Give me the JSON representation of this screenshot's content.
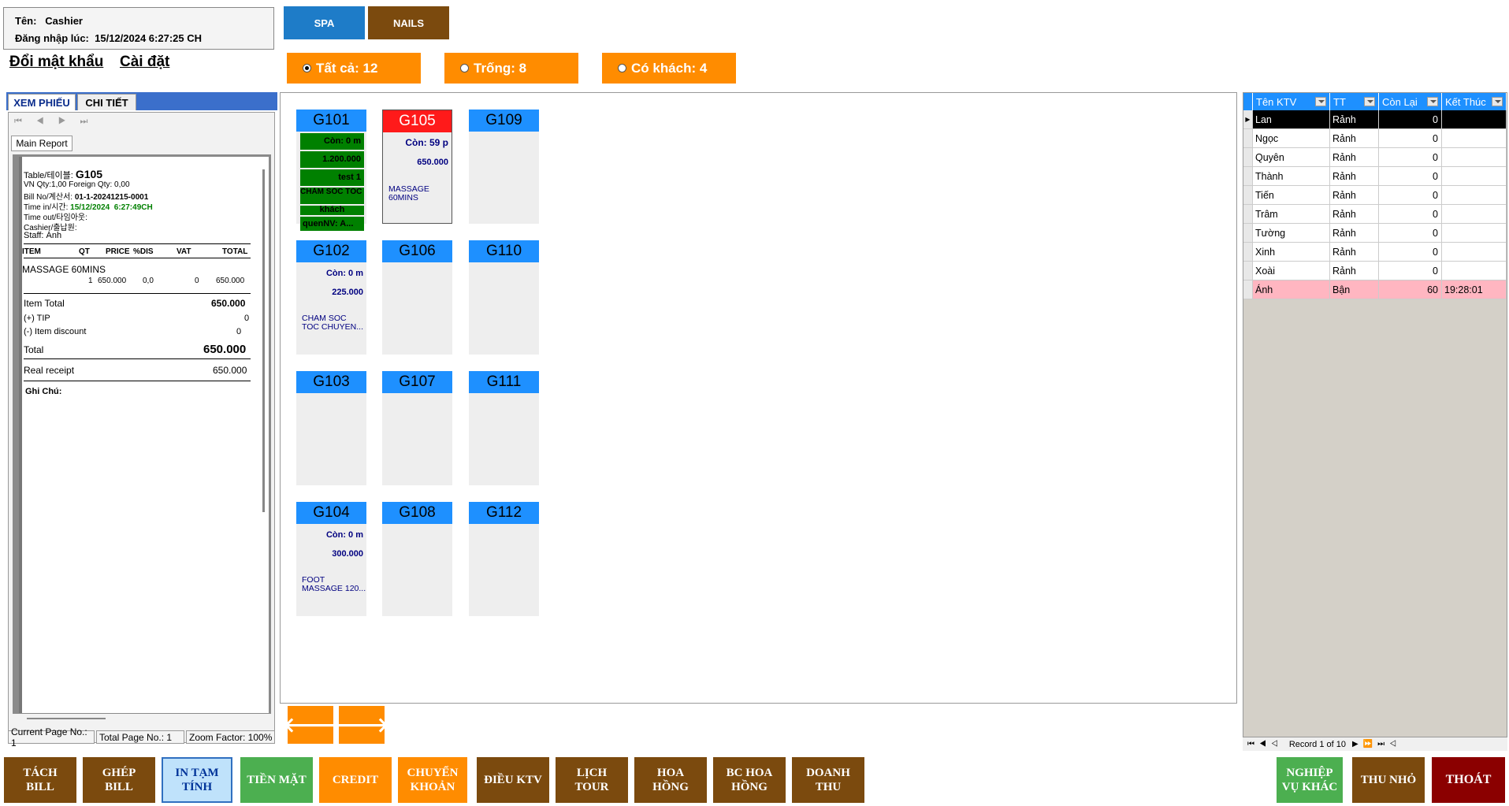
{
  "user": {
    "name_label": "Tên:",
    "name": "Cashier",
    "login_label": "Đăng nhập lúc:",
    "login_time": "15/12/2024 6:27:25 CH"
  },
  "top_tabs": {
    "spa": "SPA",
    "nails": "NAILS"
  },
  "links": {
    "change_password": "Đổi mật khẩu",
    "settings": "Cài đặt"
  },
  "filters": {
    "all": "Tất cả: 12",
    "empty": "Trống: 8",
    "occupied": "Có khách: 4"
  },
  "left_tabs": {
    "view_bill": "XEM PHIẾU",
    "detail": "CHI TIẾT"
  },
  "report": {
    "tab": "Main Report",
    "table_label": "Table/테이블:",
    "table": "G105",
    "qty_line": "VN Qty:1,00   Foreign Qty: 0,00",
    "bill_label": "Bill No/계산서:",
    "bill_no": "01-1-20241215-0001",
    "timein_label": "Time in/시간:",
    "timein_date": "15/12/2024",
    "timein_time": "6:27:49CH",
    "timeout_label": "Time out/타임아웃:",
    "cashier_label": "Cashier/출납원:",
    "staff_label": "Staff:",
    "staff": "Ánh",
    "col_item": "ITEM",
    "col_qt": "QT",
    "col_price": "PRICE",
    "col_dis": "%DIS",
    "col_vat": "VAT",
    "col_total": "TOTAL",
    "item_name": "MASSAGE 60MINS",
    "item_qt": "1",
    "item_price": "650.000",
    "item_dis": "0,0",
    "item_vat": "0",
    "item_total": "650.000",
    "item_total_label": "Item Total",
    "item_total_value": "650.000",
    "tip_label": "(+) TIP",
    "tip_value": "0",
    "discount_label": "(-)  Item discount",
    "discount_value": "0",
    "total_label": "Total",
    "total_value": "650.000",
    "receipt_label": "Real receipt",
    "receipt_value": "650.000",
    "note_label": "Ghi Chú:"
  },
  "status_bar": {
    "current_page": "Current Page No.: 1",
    "total_page": "Total Page No.: 1",
    "zoom": "Zoom Factor: 100%"
  },
  "rooms": {
    "g101": {
      "name": "G101",
      "remain": "Còn: 0 m",
      "amount": "1.200.000",
      "note": "test 1",
      "service": "CHĂM SÓC TÓC + HA...",
      "extra": "khách",
      "staff": "quenNV: A..."
    },
    "g102": {
      "name": "G102",
      "remain": "Còn: 0 m",
      "amount": "225.000",
      "service_1": "CHAM SOC",
      "service_2": "TOC CHUYEN..."
    },
    "g103": {
      "name": "G103"
    },
    "g104": {
      "name": "G104",
      "remain": "Còn: 0 m",
      "amount": "300.000",
      "service_1": "FOOT",
      "service_2": "MASSAGE 120..."
    },
    "g105": {
      "name": "G105",
      "remain": "Còn: 59 p",
      "amount": "650.000",
      "service_1": "MASSAGE",
      "service_2": "60MINS"
    },
    "g106": {
      "name": "G106"
    },
    "g107": {
      "name": "G107"
    },
    "g108": {
      "name": "G108"
    },
    "g109": {
      "name": "G109"
    },
    "g110": {
      "name": "G110"
    },
    "g111": {
      "name": "G111"
    },
    "g112": {
      "name": "G112"
    }
  },
  "grid": {
    "headers": [
      "Tên KTV",
      "TT",
      "Còn Lại",
      "Kết Thúc"
    ],
    "rows": [
      {
        "name": "Lan",
        "status": "Rảnh",
        "remain": "0",
        "end": ""
      },
      {
        "name": "Ngọc",
        "status": "Rảnh",
        "remain": "0",
        "end": ""
      },
      {
        "name": "Quyên",
        "status": "Rảnh",
        "remain": "0",
        "end": ""
      },
      {
        "name": "Thành",
        "status": "Rảnh",
        "remain": "0",
        "end": ""
      },
      {
        "name": "Tiến",
        "status": "Rảnh",
        "remain": "0",
        "end": ""
      },
      {
        "name": "Trâm",
        "status": "Rảnh",
        "remain": "0",
        "end": ""
      },
      {
        "name": "Tường",
        "status": "Rảnh",
        "remain": "0",
        "end": ""
      },
      {
        "name": "Xinh",
        "status": "Rảnh",
        "remain": "0",
        "end": ""
      },
      {
        "name": "Xoài",
        "status": "Rảnh",
        "remain": "0",
        "end": ""
      },
      {
        "name": "Ánh",
        "status": "Bận",
        "remain": "60",
        "end": "19:28:01"
      }
    ],
    "record_label": "Record 1 of 10"
  },
  "bottom_buttons": {
    "split_bill": [
      "TÁCH",
      "BILL"
    ],
    "merge_bill": [
      "GHÉP",
      "BILL"
    ],
    "print_temp": [
      "IN TẠM",
      "TÍNH"
    ],
    "cash": "TIỀN MẶT",
    "credit": "CREDIT",
    "transfer": [
      "CHUYỂN",
      "KHOẢN"
    ],
    "assign_ktv": "ĐIỀU KTV",
    "tour_schedule": [
      "LỊCH",
      "TOUR"
    ],
    "commission": [
      "HOA",
      "HỒNG"
    ],
    "commission_report": [
      "BC HOA",
      "HỒNG"
    ],
    "revenue": [
      "DOANH",
      "THU"
    ],
    "other": [
      "NGHIỆP",
      "VỤ KHÁC"
    ],
    "minimize": "THU NHỎ",
    "exit": "THOÁT"
  },
  "colors": {
    "accent_blue": "#1e90ff",
    "orange": "#ff8c00",
    "brown": "#7b4a0e",
    "busy_room": "#ff1a1a",
    "occupied_bar": "#008000",
    "exit": "#8b0000"
  }
}
